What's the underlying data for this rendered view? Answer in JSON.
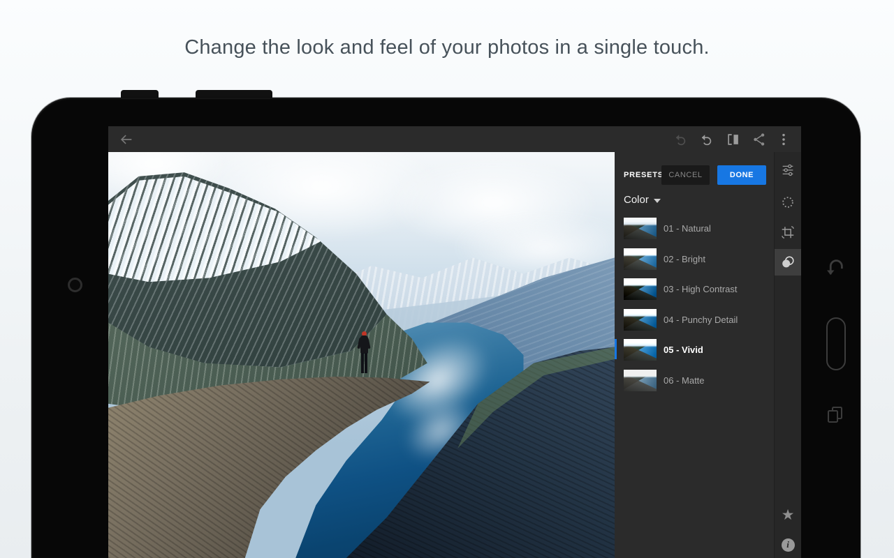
{
  "page": {
    "tagline": "Change the look and feel of your photos in a single touch."
  },
  "app": {
    "toolbar": {
      "icons": [
        "back-arrow",
        "redo",
        "undo",
        "before-after-compare",
        "share",
        "overflow-menu"
      ]
    },
    "photo": {
      "description": "Hiker with red cap standing on Trolltunga rock ledge above a blue fjord between snow-capped mountains"
    },
    "presets_panel": {
      "title": "PRESETS",
      "cancel_label": "CANCEL",
      "done_label": "DONE",
      "accent_color": "#1777e3",
      "category": {
        "label": "Color"
      },
      "items": [
        {
          "label": "01 - Natural",
          "selected": false
        },
        {
          "label": "02 - Bright",
          "selected": false
        },
        {
          "label": "03 - High Contrast",
          "selected": false
        },
        {
          "label": "04 - Punchy Detail",
          "selected": false
        },
        {
          "label": "05 - Vivid",
          "selected": true
        },
        {
          "label": "06 - Matte",
          "selected": false
        }
      ]
    },
    "tool_sidebar": {
      "tools": [
        {
          "name": "adjustments",
          "selected": false
        },
        {
          "name": "selective-edit",
          "selected": false
        },
        {
          "name": "crop-rotate",
          "selected": false
        },
        {
          "name": "presets",
          "selected": true
        }
      ],
      "bottom": [
        {
          "name": "favorite-star"
        },
        {
          "name": "info"
        }
      ]
    }
  }
}
